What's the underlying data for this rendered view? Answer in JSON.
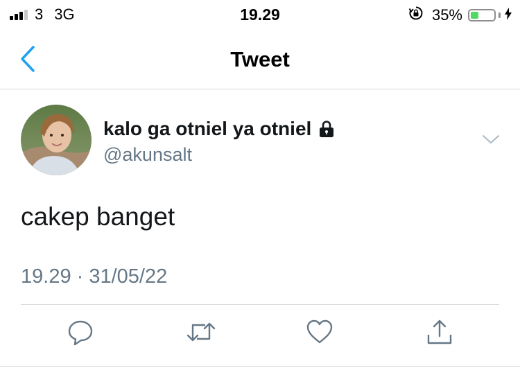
{
  "status_bar": {
    "carrier": "3",
    "network": "3G",
    "time": "19.29",
    "battery_percent": "35%",
    "battery_level": 0.35,
    "icons": [
      "signal-icon",
      "rotation-lock-icon",
      "battery-icon",
      "charging-bolt-icon"
    ]
  },
  "nav": {
    "title": "Tweet",
    "back_icon": "chevron-left-icon",
    "accent_color": "#1da1f2"
  },
  "tweet": {
    "display_name": "kalo ga otniel ya otniel",
    "protected_icon": "lock-icon",
    "handle": "@akunsalt",
    "text": "cakep banget",
    "timestamp": "19.29 · 31/05/22",
    "menu_icon": "chevron-down-icon"
  },
  "actions": [
    {
      "icon": "reply-icon"
    },
    {
      "icon": "retweet-icon"
    },
    {
      "icon": "like-icon"
    },
    {
      "icon": "share-icon"
    }
  ],
  "colors": {
    "text_primary": "#14171a",
    "text_secondary": "#657786",
    "divider": "#d6d9db",
    "battery_fill": "#4cd964"
  }
}
